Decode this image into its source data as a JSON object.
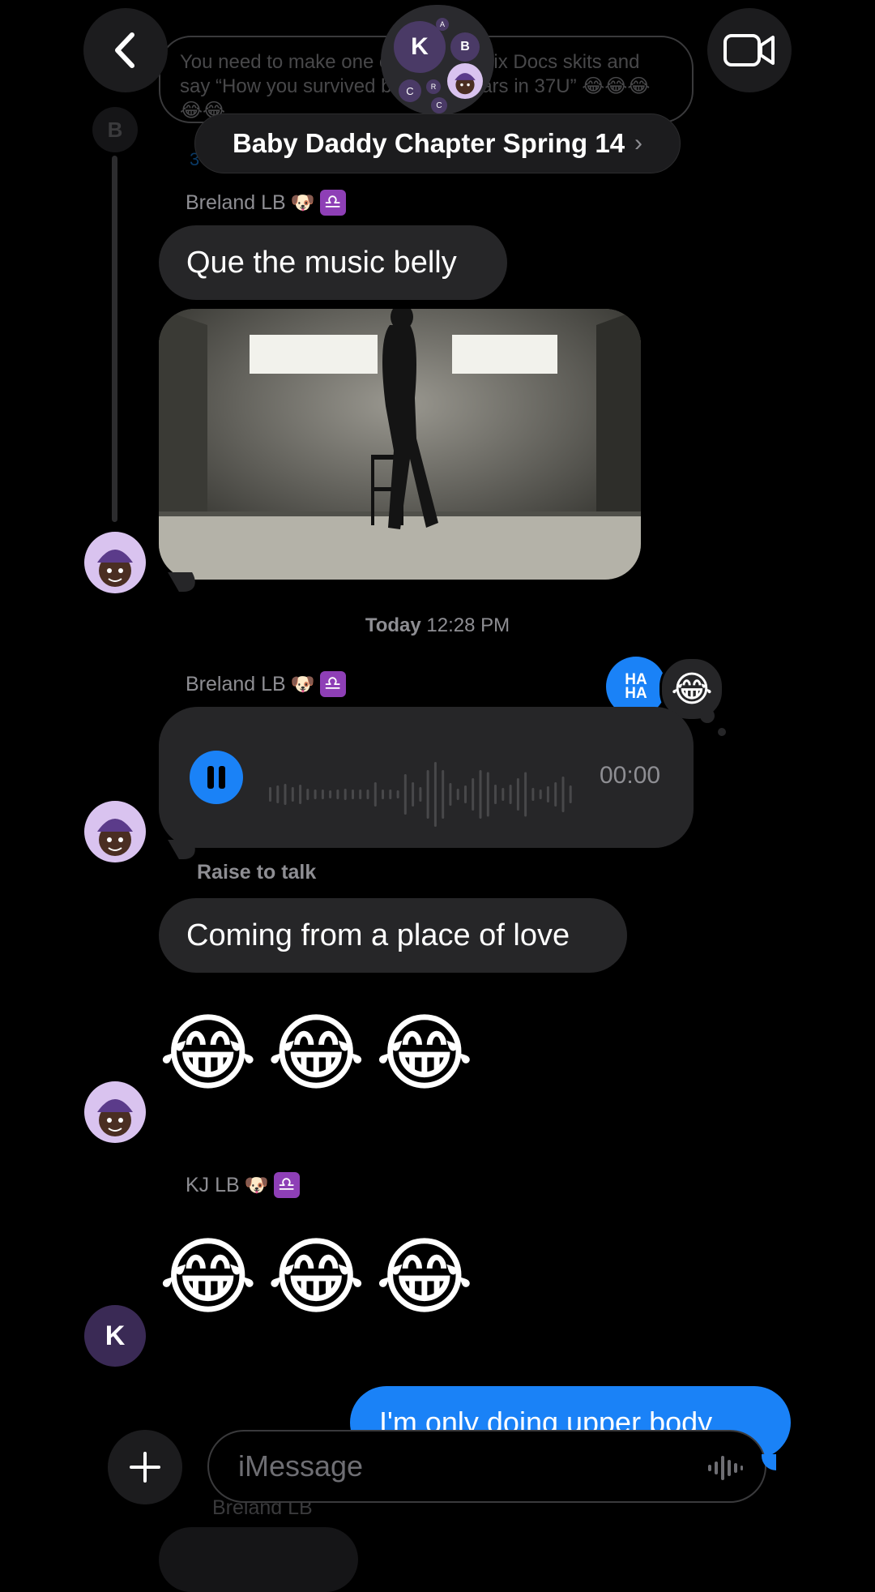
{
  "header": {
    "title": "Baby Daddy Chapter Spring 14",
    "group_initials": [
      "K",
      "B",
      "A",
      "C",
      "R",
      "C"
    ],
    "previous_message_preview": "You need to make one of those Netflix Docs skits and say “How you survived being 20 years in 37U” 😂😂😂😂😂",
    "replies_label": "3 Replies",
    "thread_avatar_initial": "B"
  },
  "messages": {
    "sender_1": "Breland LB",
    "sender_1_emoji": "🐶",
    "zodiac": "♎",
    "msg_1": "Que the music belly",
    "timestamp_day": "Today",
    "timestamp_time": "12:28 PM",
    "sender_2": "Breland LB",
    "audio_time": "00:00",
    "raise_to_talk": "Raise to talk",
    "msg_2": "Coming from a place of love",
    "emoji_group_1": [
      "😂",
      "😂",
      "😂"
    ],
    "sender_3": "KJ LB",
    "emoji_group_2": [
      "😂",
      "😂",
      "😂"
    ],
    "avatar_k": "K",
    "outgoing_msg": "I'm only doing upper body",
    "next_sender": "Breland LB"
  },
  "reactions": {
    "haha_label": "HA HA",
    "laugh_emoji": "😂"
  },
  "input": {
    "placeholder": "iMessage"
  },
  "colors": {
    "background": "#000000",
    "bubble_gray": "#262628",
    "imessage_blue": "#1a82f7",
    "libra_purple": "#8e3fb6"
  }
}
